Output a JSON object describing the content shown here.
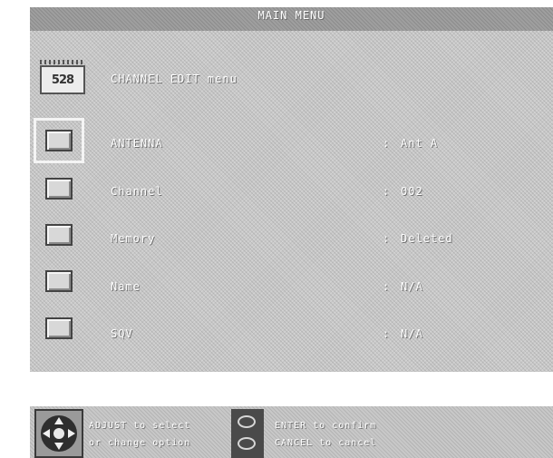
{
  "title": "MAIN MENU",
  "menu_icon": {
    "big": "5",
    "sup": "2",
    "sub": "8"
  },
  "header": "CHANNEL EDIT menu",
  "rows": [
    {
      "label": "ANTENNA",
      "value": "Ant A",
      "selected": true
    },
    {
      "label": "Channel",
      "value": "002",
      "selected": false
    },
    {
      "label": "Memory",
      "value": "Deleted",
      "selected": false
    },
    {
      "label": "Name",
      "value": "N/A",
      "selected": false
    },
    {
      "label": "SQV",
      "value": "N/A",
      "selected": false
    }
  ],
  "separator": ":",
  "hints": {
    "adjust_line1": "ADJUST to select",
    "adjust_line2": "or change option",
    "enter_line": "ENTER to confirm",
    "cancel_line": "CANCEL to cancel"
  }
}
